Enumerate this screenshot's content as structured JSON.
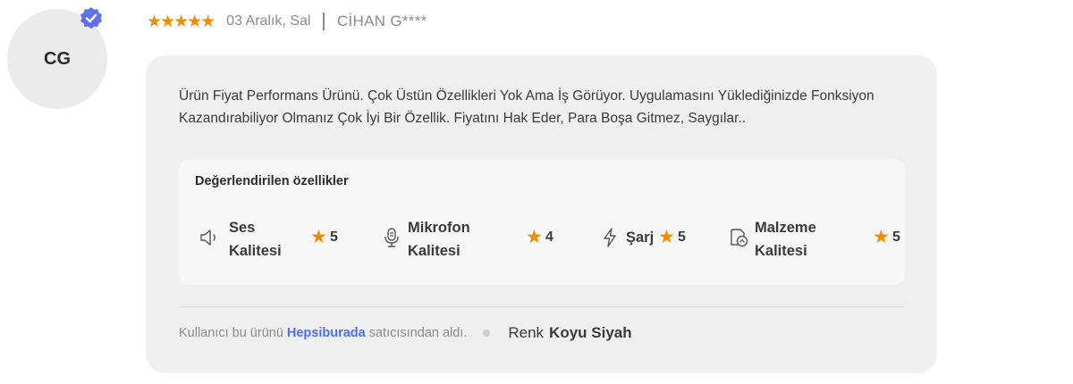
{
  "reviewer": {
    "initials": "CG",
    "name": "CİHAN G****",
    "verified_icon": "verified-badge-icon",
    "verified_color": "#5c6ff5"
  },
  "review": {
    "stars": "★★★★★",
    "rating": 5,
    "date": "03 Aralık, Sal",
    "text": "Ürün Fiyat Performans Ürünü. Çok Üstün Özellikleri Yok Ama İş Görüyor. Uygulamasını Yüklediğinizde Fonksiyon Kazandırabiliyor Olmanız Çok İyi Bir Özellik. Fiyatını Hak Eder, Para Boşa Gitmez, Saygılar.."
  },
  "features": {
    "title": "Değerlendirilen özellikler",
    "items": [
      {
        "icon": "speaker-icon",
        "name_line1": "Ses",
        "name_line2": "Kalitesi",
        "rating": "5"
      },
      {
        "icon": "microphone-icon",
        "name_line1": "Mikrofon",
        "name_line2": "Kalitesi",
        "rating": "4"
      },
      {
        "icon": "lightning-icon",
        "name_line1": "Şarj",
        "name_line2": "",
        "rating": "5"
      },
      {
        "icon": "material-icon",
        "name_line1": "Malzeme",
        "name_line2": "Kalitesi",
        "rating": "5"
      }
    ]
  },
  "purchase": {
    "prefix": "Kullanıcı bu ürünü",
    "seller": "Hepsiburada",
    "suffix": "satıcısından aldı.",
    "color_label": "Renk",
    "color_value": "Koyu Siyah"
  },
  "colors": {
    "star": "#f28b00",
    "accent": "#4c6fff",
    "card_bg": "#efefef"
  }
}
